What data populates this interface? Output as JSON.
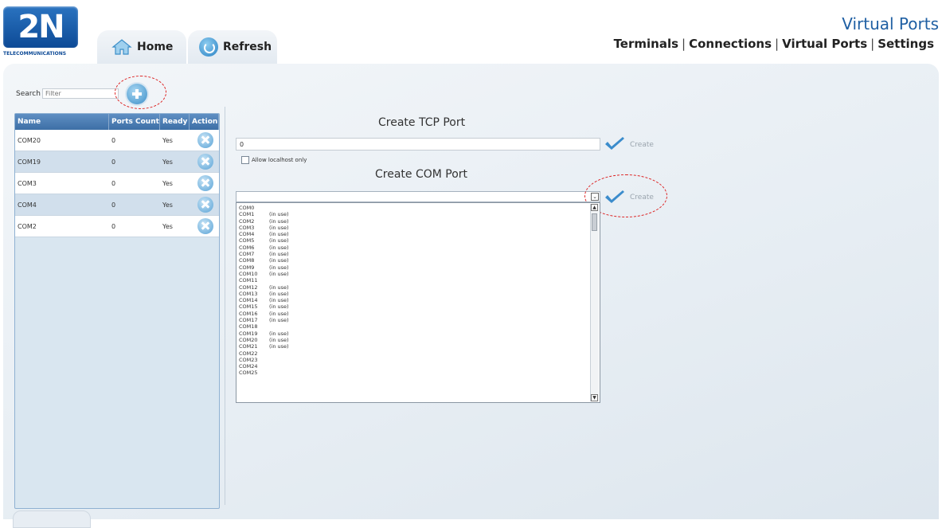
{
  "header": {
    "logo_text": "2N",
    "logo_subtitle": "TELECOMMUNICATIONS",
    "page_title": "Virtual Ports",
    "tabs": [
      {
        "label": "Home",
        "icon": "home-icon"
      },
      {
        "label": "Refresh",
        "icon": "refresh-icon"
      }
    ],
    "nav": [
      "Terminals",
      "Connections",
      "Virtual Ports",
      "Settings"
    ],
    "nav_separator": "|"
  },
  "sidebar": {
    "search_label": "Search",
    "search_placeholder": "Filter",
    "columns": [
      "Name",
      "Ports Count",
      "Ready",
      "Action"
    ],
    "rows": [
      {
        "name": "COM20",
        "ports_count": "0",
        "ready": "Yes"
      },
      {
        "name": "COM19",
        "ports_count": "0",
        "ready": "Yes"
      },
      {
        "name": "COM3",
        "ports_count": "0",
        "ready": "Yes"
      },
      {
        "name": "COM4",
        "ports_count": "0",
        "ready": "Yes"
      },
      {
        "name": "COM2",
        "ports_count": "0",
        "ready": "Yes"
      }
    ]
  },
  "tcp": {
    "title": "Create TCP Port",
    "input_value": "0",
    "create_label": "Create",
    "checkbox_label": "Allow localhost only"
  },
  "com": {
    "title": "Create COM Port",
    "create_label": "Create",
    "list": [
      {
        "name": "COM0",
        "status": ""
      },
      {
        "name": "COM1",
        "status": "(in use)"
      },
      {
        "name": "COM2",
        "status": "(in use)"
      },
      {
        "name": "COM3",
        "status": "(in use)"
      },
      {
        "name": "COM4",
        "status": "(in use)"
      },
      {
        "name": "COM5",
        "status": "(in use)"
      },
      {
        "name": "COM6",
        "status": "(in use)"
      },
      {
        "name": "COM7",
        "status": "(in use)"
      },
      {
        "name": "COM8",
        "status": "(in use)"
      },
      {
        "name": "COM9",
        "status": "(in use)"
      },
      {
        "name": "COM10",
        "status": "(in use)"
      },
      {
        "name": "COM11",
        "status": ""
      },
      {
        "name": "COM12",
        "status": "(in use)"
      },
      {
        "name": "COM13",
        "status": "(in use)"
      },
      {
        "name": "COM14",
        "status": "(in use)"
      },
      {
        "name": "COM15",
        "status": "(in use)"
      },
      {
        "name": "COM16",
        "status": "(in use)"
      },
      {
        "name": "COM17",
        "status": "(in use)"
      },
      {
        "name": "COM18",
        "status": ""
      },
      {
        "name": "COM19",
        "status": "(in use)"
      },
      {
        "name": "COM20",
        "status": "(in use)"
      },
      {
        "name": "COM21",
        "status": "(in use)"
      },
      {
        "name": "COM22",
        "status": ""
      },
      {
        "name": "COM23",
        "status": ""
      },
      {
        "name": "COM24",
        "status": ""
      },
      {
        "name": "COM25",
        "status": ""
      }
    ]
  },
  "colors": {
    "accent": "#1f5fa3",
    "grid_header": "#4a7db4",
    "check": "#3b8ccc",
    "highlight_ellipse": "#dd2222"
  }
}
